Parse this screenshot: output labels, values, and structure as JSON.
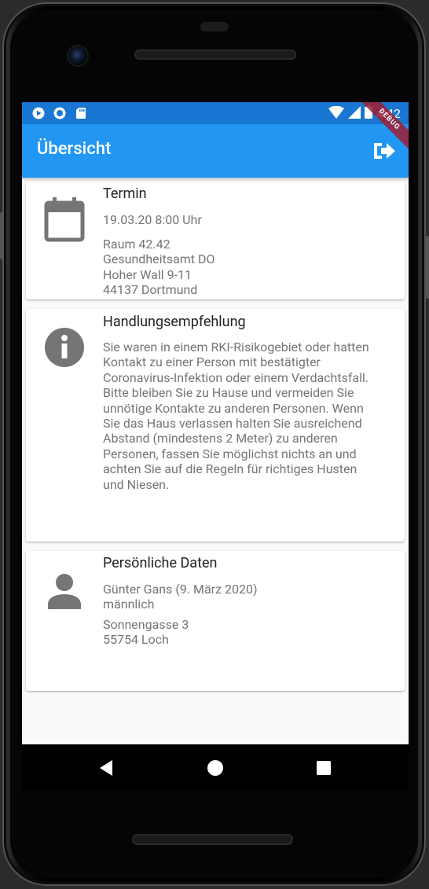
{
  "status_bar": {
    "time": "4:42",
    "debug_banner": "DEBUG",
    "icons_left": [
      "play-protect-icon",
      "sync-icon",
      "sd-card-icon"
    ],
    "icons_right": [
      "wifi-icon",
      "signal-icon",
      "battery-icon"
    ]
  },
  "app_bar": {
    "title": "Übersicht",
    "action_icon": "logout-icon",
    "color": "#2196f3"
  },
  "cards": {
    "appointment": {
      "icon": "calendar-icon",
      "title": "Termin",
      "datetime": "19.03.20 8:00 Uhr",
      "address": "Raum 42.42\nGesundheitsamt DO\nHoher Wall 9-11\n44137 Dortmund"
    },
    "recommendation": {
      "icon": "info-icon",
      "title": "Handlungsempfehlung",
      "text": "Sie waren in einem RKI-Risikogebiet oder hatten\nKontakt zu einer Person mit bestätigter\nCoronavirus-Infektion oder einem Verdachtsfall.\nBitte bleiben Sie zu Hause und vermeiden Sie\nunnötige Kontakte zu anderen Personen.  Wenn\nSie das Haus verlassen halten Sie ausreichend\nAbstand (mindestens 2 Meter) zu anderen\nPersonen, fassen Sie möglichst nichts an und\nachten Sie auf die Regeln für richtiges Husten\nund Niesen."
    },
    "personal": {
      "icon": "person-icon",
      "title": "Persönliche Daten",
      "name_date": "Günter Gans (9. März 2020)",
      "gender": "männlich",
      "address": "Sonnengasse 3\n55754 Loch"
    }
  },
  "nav_bar": {
    "buttons": [
      "back-icon",
      "home-icon",
      "recents-icon"
    ]
  }
}
